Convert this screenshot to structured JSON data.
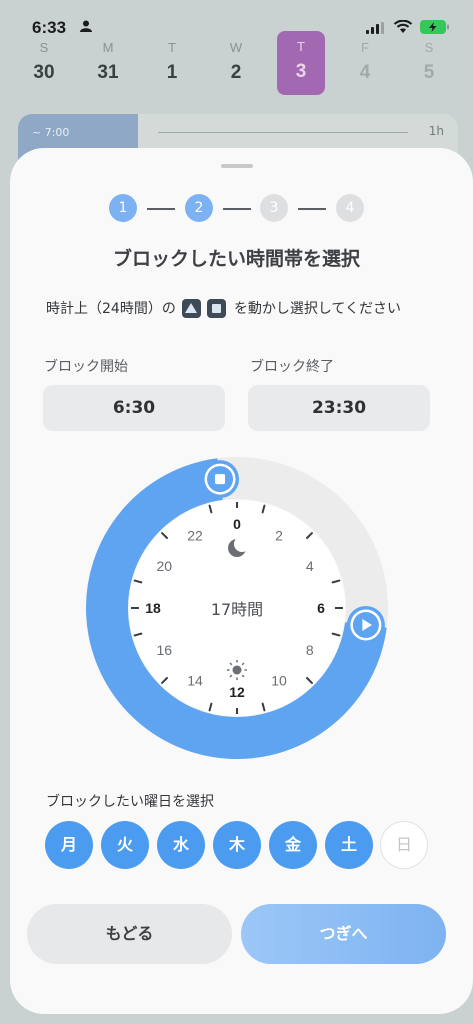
{
  "status_bar": {
    "time": "6:33"
  },
  "week": [
    {
      "dow": "S",
      "num": "30",
      "state": "normal"
    },
    {
      "dow": "M",
      "num": "31",
      "state": "normal"
    },
    {
      "dow": "T",
      "num": "1",
      "state": "normal"
    },
    {
      "dow": "W",
      "num": "2",
      "state": "normal"
    },
    {
      "dow": "T",
      "num": "3",
      "state": "selected"
    },
    {
      "dow": "F",
      "num": "4",
      "state": "muted"
    },
    {
      "dow": "S",
      "num": "5",
      "state": "muted"
    }
  ],
  "background_card": {
    "time_label": "~ 7:00",
    "duration": "1h"
  },
  "steps": [
    "1",
    "2",
    "3",
    "4"
  ],
  "current_step": 2,
  "title": "ブロックしたい時間帯を選択",
  "instruction": {
    "prefix": "時計上（24時間）の",
    "connector": "",
    "suffix": "を動かし選択してください"
  },
  "block_start": {
    "label": "ブロック開始",
    "value": "6:30"
  },
  "block_end": {
    "label": "ブロック終了",
    "value": "23:30"
  },
  "clock": {
    "center_label": "17時間",
    "hour_labels": [
      "0",
      "2",
      "4",
      "6",
      "8",
      "10",
      "12",
      "14",
      "16",
      "18",
      "20",
      "22"
    ],
    "start_hour": 6.5,
    "end_hour": 23.5,
    "accent_color": "#5fa4f0"
  },
  "weekday_section": {
    "label": "ブロックしたい曜日を選択",
    "days": [
      {
        "label": "月",
        "selected": true
      },
      {
        "label": "火",
        "selected": true
      },
      {
        "label": "水",
        "selected": true
      },
      {
        "label": "木",
        "selected": true
      },
      {
        "label": "金",
        "selected": true
      },
      {
        "label": "土",
        "selected": true
      },
      {
        "label": "日",
        "selected": false
      }
    ]
  },
  "buttons": {
    "back": "もどる",
    "next": "つぎへ"
  }
}
